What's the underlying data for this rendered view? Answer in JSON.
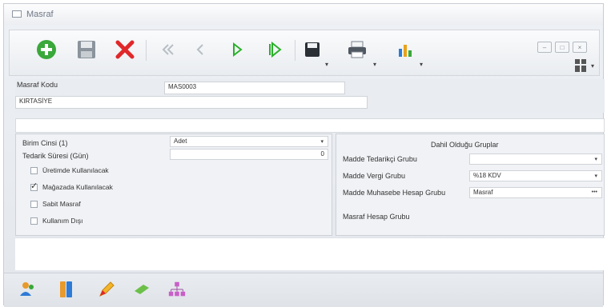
{
  "window": {
    "title": "Masraf"
  },
  "toolbar": {
    "buttons": [
      {
        "name": "add",
        "icon": "plus-circle-icon"
      },
      {
        "name": "save",
        "icon": "floppy-icon"
      },
      {
        "name": "delete",
        "icon": "x-icon"
      },
      {
        "name": "first",
        "icon": "first-record-icon"
      },
      {
        "name": "previous",
        "icon": "previous-record-icon"
      },
      {
        "name": "next",
        "icon": "next-record-icon"
      },
      {
        "name": "last",
        "icon": "last-record-icon"
      },
      {
        "name": "save-options",
        "icon": "floppy-dropdown-icon"
      },
      {
        "name": "print",
        "icon": "printer-icon"
      },
      {
        "name": "report",
        "icon": "chart-icon"
      }
    ],
    "colors": {
      "add": "#3aa83a",
      "delete": "#e0282a",
      "nav": "#2ab02a"
    }
  },
  "header": {
    "code_label": "Masraf Kodu",
    "code_value": "MAS0003",
    "name_value": "KIRTASİYE"
  },
  "left_group": {
    "unit_type_label": "Birim Cinsi (1)",
    "unit_type_value": "Adet",
    "lead_time_label": "Tedarik Süresi (Gün)",
    "lead_time_value": "0",
    "checkboxes": [
      {
        "label": "Üretimde Kullanılacak",
        "checked": false
      },
      {
        "label": "Mağazada Kullanılacak",
        "checked": true
      },
      {
        "label": "Sabit Masraf",
        "checked": false
      },
      {
        "label": "Kullanım Dışı",
        "checked": false
      }
    ]
  },
  "right_group": {
    "title": "Dahil Olduğu Gruplar",
    "rows": [
      {
        "label": "Madde Tedarikçi Grubu",
        "value": ""
      },
      {
        "label": "Madde Vergi Grubu",
        "value": "%18 KDV"
      },
      {
        "label": "Madde Muhasebe Hesap Grubu",
        "value": "Masraf"
      }
    ],
    "expense_account_label": "Masraf Hesap Grubu"
  },
  "bottom_icons": [
    "users-icon",
    "binder-icon",
    "pencil-icon",
    "eraser-icon",
    "hierarchy-icon"
  ]
}
